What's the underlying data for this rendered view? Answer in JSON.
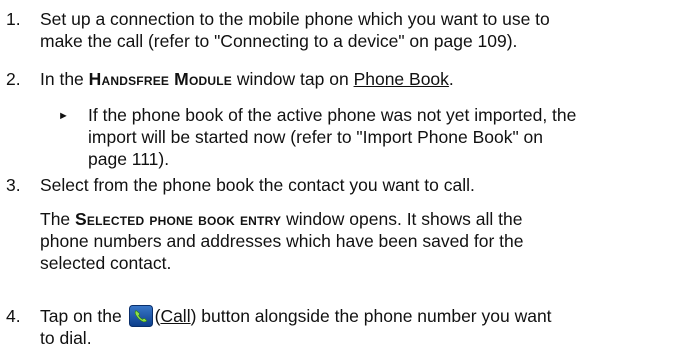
{
  "steps": [
    {
      "number": "1.",
      "line1": "Set up a connection to the mobile phone which you want to use to",
      "line2": "make the call (refer to \"Connecting to a device\" on page 109)."
    },
    {
      "number": "2.",
      "pre": "In the ",
      "window_name": "Handsfree Module",
      "mid": " window tap on ",
      "link": "Phone Book",
      "post": "."
    },
    {
      "bullet_line1": "If the phone book of the active phone was not yet imported, the",
      "bullet_line2": "import will be started now (refer to \"Import Phone Book\" on",
      "bullet_line3": "page 111)."
    },
    {
      "number": "3.",
      "line1": "Select from the phone book the contact you want to call.",
      "pre": "The ",
      "window_name": "Selected phone book entry",
      "post": " window opens. It shows all the",
      "line3": "phone numbers and addresses which have been saved for the",
      "line4": "selected contact."
    },
    {
      "number": "4.",
      "pre": "Tap on the ",
      "icon": "call-phone-icon",
      "link_prefix": "(",
      "link": "Call",
      "link_suffix": ")",
      "post": " button alongside the phone number you want",
      "line2": "to dial."
    }
  ]
}
